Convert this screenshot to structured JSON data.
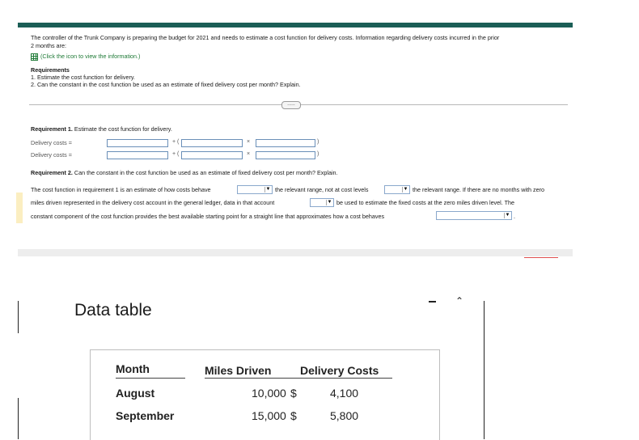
{
  "problem": {
    "intro_line1": "The controller of the Trunk Company is preparing the budget for 2021 and needs to estimate a cost function for delivery costs. Information regarding delivery costs incurred in the prior",
    "intro_line2": "2 months are:",
    "info_link": "(Click the icon to view the information.)",
    "requirements_heading": "Requirements",
    "req1": "1. Estimate the cost function for delivery.",
    "req2": "2. Can the constant in the cost function be used as an estimate of fixed delivery cost per month? Explain.",
    "expand_button": "....."
  },
  "requirement1": {
    "heading_bold": "Requirement 1.",
    "heading_rest": " Estimate the cost function for delivery.",
    "row1_label": "Delivery costs =",
    "row2_label": "Delivery costs =",
    "plus_paren": "+ (",
    "times": "×",
    "close_paren": ")",
    "inputs": [
      "",
      "",
      "",
      "",
      "",
      ""
    ]
  },
  "requirement2": {
    "heading_bold": "Requirement 2.",
    "heading_rest": " Can the constant in the cost function be used as an estimate of fixed delivery cost per month? Explain.",
    "line1_a": "The cost function in requirement 1 is an estimate of how costs behave",
    "line1_b": "the relevant range, not at cost levels",
    "line1_c": "the relevant range. If there are no months with zero",
    "line2_a": "miles driven represented in the delivery cost account in the general ledger, data in that account",
    "line2_b": "be used to estimate the fixed costs at the zero miles driven level. The",
    "line3_a": "constant component of the cost function provides the best available starting point for a straight line that approximates how a cost behaves",
    "line3_end": ".",
    "dropdowns": [
      "",
      "",
      "",
      ""
    ]
  },
  "data_table": {
    "title": "Data table",
    "headers": [
      "Month",
      "Miles Driven",
      "Delivery Costs"
    ],
    "rows": [
      {
        "month": "August",
        "miles": "10,000",
        "currency": "$",
        "cost": "4,100"
      },
      {
        "month": "September",
        "miles": "15,000",
        "currency": "$",
        "cost": "5,800"
      }
    ]
  },
  "colors": {
    "top_bar": "#1b5e56",
    "link_green": "#1e7a36",
    "input_border": "#6a8fb8"
  }
}
